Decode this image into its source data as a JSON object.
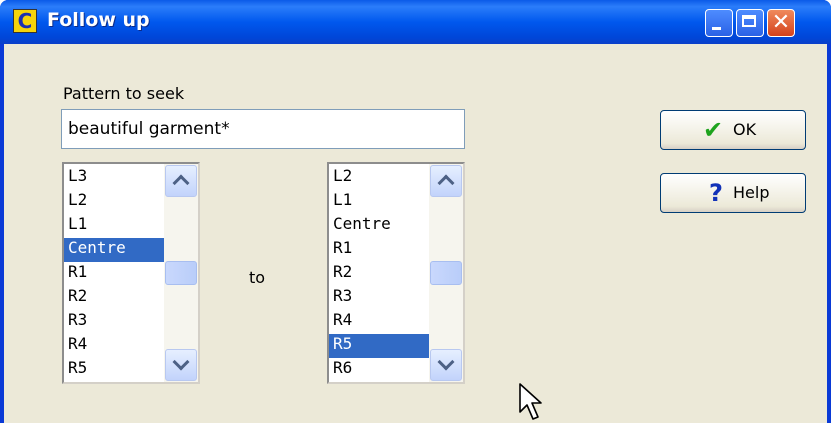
{
  "window": {
    "title": "Follow up",
    "icon_letter": "C"
  },
  "form": {
    "pattern_label": "Pattern to seek",
    "pattern_value": "beautiful garment*",
    "to_label": "to"
  },
  "list_from": {
    "items": [
      "L3",
      "L2",
      "L1",
      "Centre",
      "R1",
      "R2",
      "R3",
      "R4",
      "R5"
    ],
    "selected": "Centre"
  },
  "list_to": {
    "items": [
      "L2",
      "L1",
      "Centre",
      "R1",
      "R2",
      "R3",
      "R4",
      "R5",
      "R6"
    ],
    "selected": "R5"
  },
  "buttons": {
    "ok_label": "OK",
    "ok_icon": "check-icon",
    "help_label": "Help",
    "help_icon": "question-icon"
  },
  "colors": {
    "selection": "#316ac5",
    "titlebar": "#0058ee"
  }
}
